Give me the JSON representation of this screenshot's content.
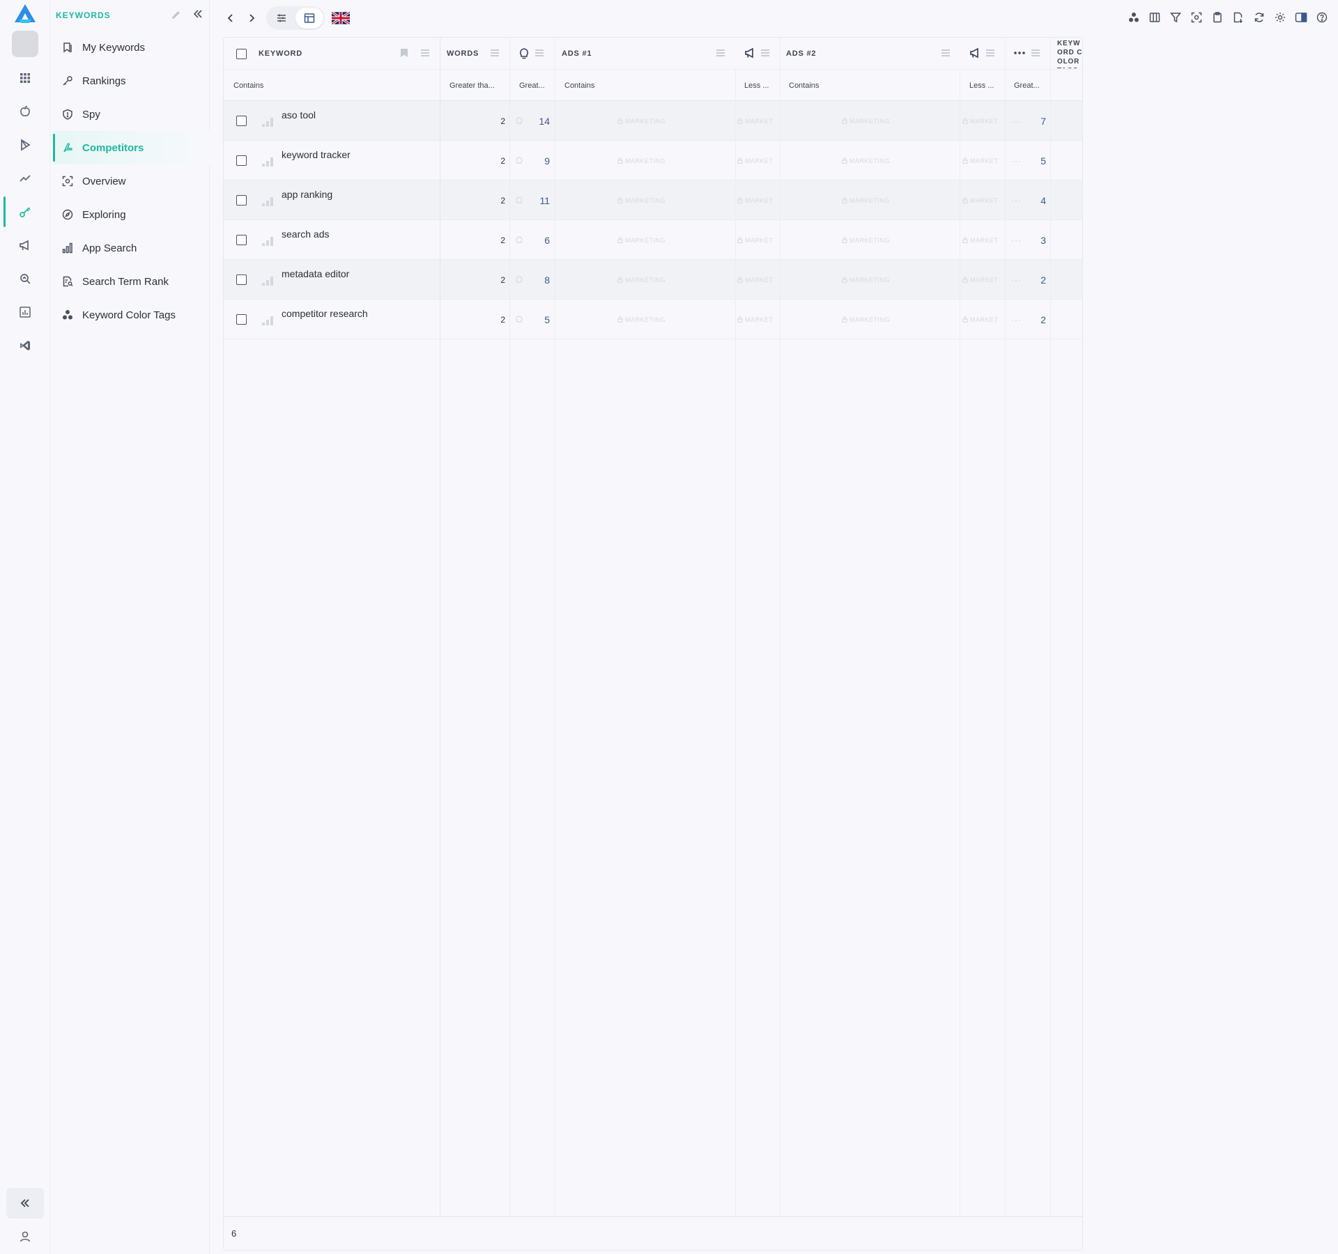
{
  "sidebar": {
    "title": "KEYWORDS",
    "items": [
      {
        "label": "My Keywords",
        "icon": "bookmark-list-icon"
      },
      {
        "label": "Rankings",
        "icon": "key-icon"
      },
      {
        "label": "Spy",
        "icon": "shield-icon"
      },
      {
        "label": "Competitors",
        "icon": "competitors-icon",
        "active": true
      },
      {
        "label": "Overview",
        "icon": "overview-icon"
      },
      {
        "label": "Exploring",
        "icon": "compass-icon"
      },
      {
        "label": "App Search",
        "icon": "bar-chart-icon"
      },
      {
        "label": "Search Term Rank",
        "icon": "document-search-icon"
      },
      {
        "label": "Keyword Color Tags",
        "icon": "color-tags-icon"
      }
    ]
  },
  "rail": {
    "icons": [
      "grid-icon",
      "apple-icon",
      "play-icon",
      "trend-icon",
      "keyword-key-icon",
      "megaphone-icon",
      "search-analytics-icon",
      "report-icon",
      "vs-code-icon"
    ],
    "active_index": 4
  },
  "toolbar": {
    "flag": "uk-flag-icon",
    "right_icons": [
      "color-tags-icon",
      "columns-icon",
      "filter-icon",
      "focus-icon",
      "clipboard-icon",
      "export-icon",
      "refresh-icon",
      "settings-icon",
      "panel-icon",
      "help-icon"
    ]
  },
  "table": {
    "headers": {
      "keyword": "KEYWORD",
      "words": "WORDS",
      "ads1": "ADS #1",
      "ads2": "ADS #2",
      "color_tags": "KEYWORD COLOR TAGS"
    },
    "filters": {
      "keyword": "Contains",
      "words": "Greater tha...",
      "popularity": "Great...",
      "ads1": "Contains",
      "ads1_small": "Less ...",
      "ads2": "Contains",
      "ads2_small": "Less ...",
      "more": "Great..."
    },
    "locked_label": "MARKETING",
    "locked_short": "MARKET",
    "rows": [
      {
        "keyword": "aso tool",
        "words": "2",
        "popularity": "14",
        "more": "7"
      },
      {
        "keyword": "keyword tracker",
        "words": "2",
        "popularity": "9",
        "more": "5"
      },
      {
        "keyword": "app ranking",
        "words": "2",
        "popularity": "11",
        "more": "4"
      },
      {
        "keyword": "search ads",
        "words": "2",
        "popularity": "6",
        "more": "3"
      },
      {
        "keyword": "metadata editor",
        "words": "2",
        "popularity": "8",
        "more": "2"
      },
      {
        "keyword": "competitor research",
        "words": "2",
        "popularity": "5",
        "more": "2"
      }
    ],
    "footer_count": "6"
  },
  "colors": {
    "accent": "#1fb8a0",
    "number": "#3a5a8a",
    "locked": "#d6d9e0"
  }
}
